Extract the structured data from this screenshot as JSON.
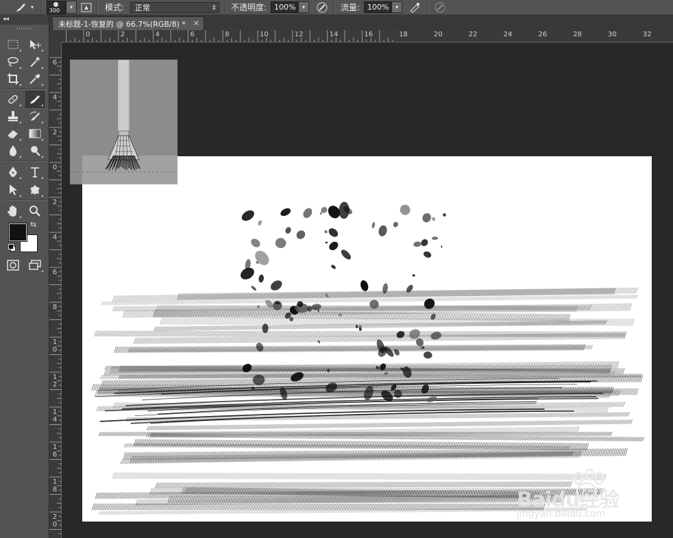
{
  "options_bar": {
    "brush_size": "300",
    "mode_label": "模式:",
    "mode_value": "正常",
    "opacity_label": "不透明度:",
    "opacity_value": "100%",
    "flow_label": "流量:",
    "flow_value": "100%"
  },
  "document_tab": {
    "title": "未标题-1-恢复的 @ 66.7%(RGB/8) *",
    "close_glyph": "×"
  },
  "ruler": {
    "horizontal_labels": [
      "0",
      "2",
      "4",
      "6",
      "8",
      "10",
      "12",
      "14",
      "16",
      "18",
      "20",
      "22",
      "24",
      "26",
      "28",
      "30",
      "32"
    ],
    "vertical_labels": [
      "6",
      "4",
      "2",
      "0",
      "2",
      "4",
      "6",
      "8",
      "10",
      "12",
      "14",
      "16",
      "18",
      "20"
    ]
  },
  "tools": [
    {
      "name": "marquee-icon"
    },
    {
      "name": "move-icon"
    },
    {
      "name": "lasso-icon"
    },
    {
      "name": "magic-wand-icon"
    },
    {
      "name": "crop-icon"
    },
    {
      "name": "eyedropper-icon"
    },
    {
      "name": "healing-brush-icon"
    },
    {
      "name": "brush-icon"
    },
    {
      "name": "clone-stamp-icon"
    },
    {
      "name": "history-brush-icon"
    },
    {
      "name": "eraser-icon"
    },
    {
      "name": "gradient-icon"
    },
    {
      "name": "blur-icon"
    },
    {
      "name": "dodge-icon"
    },
    {
      "name": "pen-icon"
    },
    {
      "name": "type-icon"
    },
    {
      "name": "path-selection-icon"
    },
    {
      "name": "custom-shape-icon"
    },
    {
      "name": "hand-icon"
    },
    {
      "name": "zoom-icon"
    }
  ],
  "colors": {
    "foreground": "#111111",
    "background": "#ffffff",
    "ui_panel": "#535353",
    "workspace": "#282828"
  },
  "watermark": {
    "brand": "Baidu经验",
    "url": "jingyan.baidu.com"
  }
}
